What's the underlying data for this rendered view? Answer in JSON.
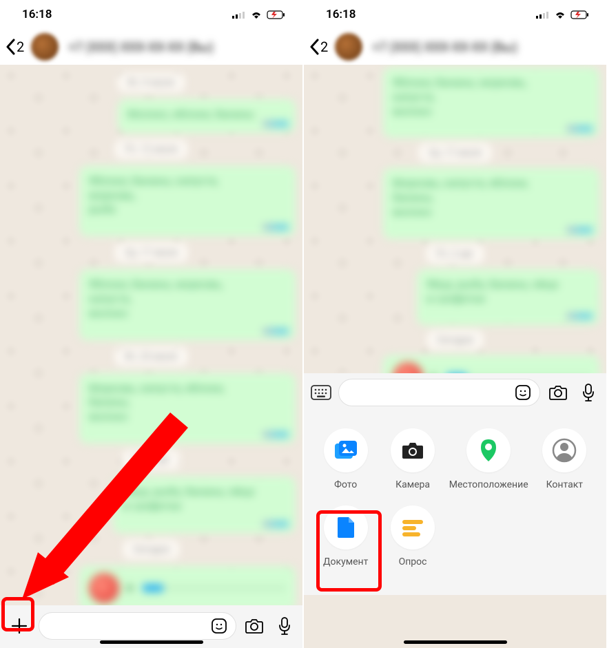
{
  "status": {
    "time": "16:18"
  },
  "header": {
    "back_count": "2",
    "contact_name_blur": "+7 (XXX) XXX-XX-XX (Вы)"
  },
  "attachments": {
    "photo": "Фото",
    "camera": "Камера",
    "location": "Местоположение",
    "contact": "Контакт",
    "document": "Документ",
    "poll": "Опрос"
  }
}
